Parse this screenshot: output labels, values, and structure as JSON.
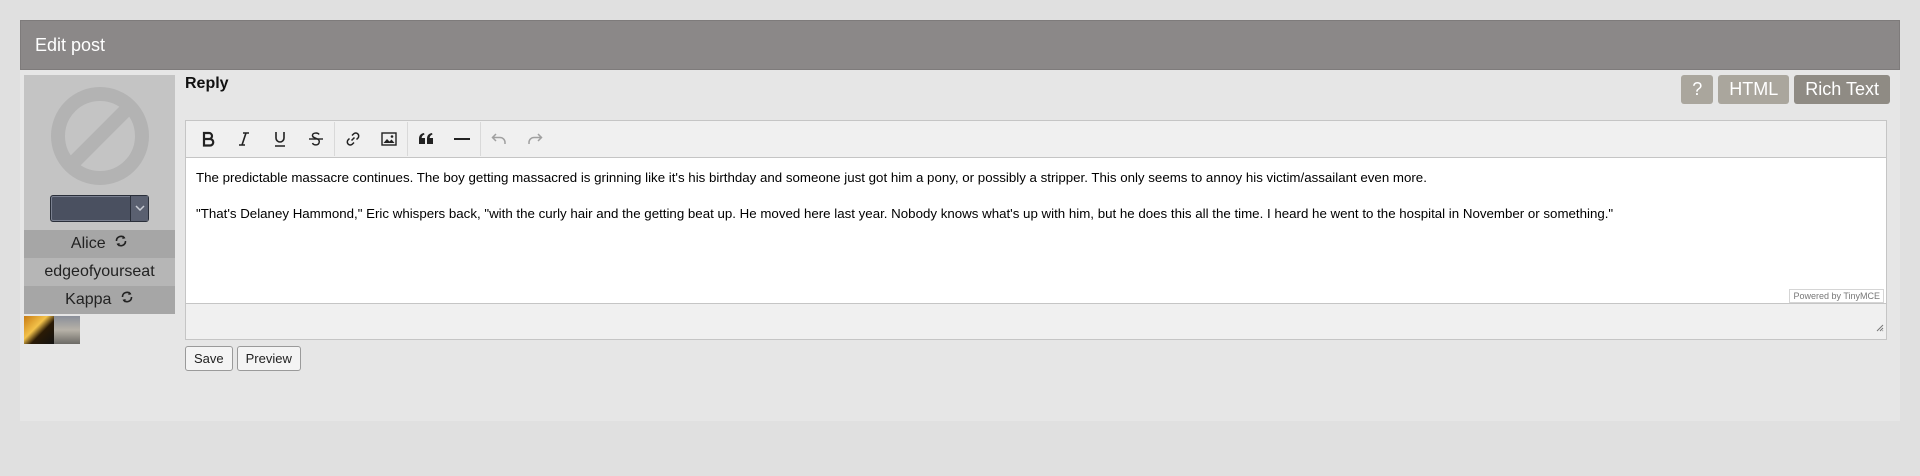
{
  "header": {
    "title": "Edit post"
  },
  "sidebar": {
    "character_select_value": "",
    "names": [
      {
        "label": "Alice",
        "has_sync": true
      },
      {
        "label": "edgeofyourseat",
        "has_sync": false
      },
      {
        "label": "Kappa",
        "has_sync": true
      }
    ]
  },
  "main": {
    "title": "Reply",
    "mode_buttons": {
      "help": "?",
      "html": "HTML",
      "rich_text": "Rich Text"
    },
    "editor": {
      "toolbar": [
        "bold-icon",
        "italic-icon",
        "underline-icon",
        "strikethrough-icon",
        "link-icon",
        "image-icon",
        "blockquote-icon",
        "horizontal-rule-icon",
        "undo-icon",
        "redo-icon"
      ],
      "paragraphs": [
        "The predictable massacre continues. The boy getting massacred is grinning like it's his birthday and someone just got him a pony, or possibly a stripper. This only seems to annoy his victim/assailant even more.",
        "\"That's Delaney Hammond,\" Eric whispers back, \"with the curly hair and the getting beat up. He moved here last year. Nobody knows what's up with him, but he does this all the time. I heard he went to the hospital in November or something.\""
      ],
      "powered_by": "Powered by TinyMCE"
    },
    "actions": {
      "save": "Save",
      "preview": "Preview"
    }
  },
  "colors": {
    "header_bg": "#8b8888",
    "active_mode_bg": "#8f8b84",
    "mode_bg": "#aaa69d"
  }
}
